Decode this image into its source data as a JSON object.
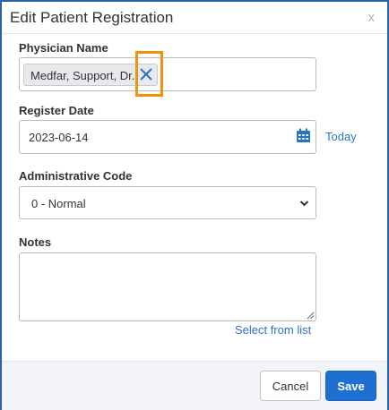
{
  "dialog": {
    "title": "Edit Patient Registration",
    "close_label": "x"
  },
  "physician": {
    "label": "Physician Name",
    "chip_value": "Medfar, Support, Dr."
  },
  "register_date": {
    "label": "Register Date",
    "value": "2023-06-14",
    "today_link": "Today"
  },
  "admin_code": {
    "label": "Administrative Code",
    "selected": "0 - Normal"
  },
  "notes": {
    "label": "Notes",
    "value": "",
    "select_from_list": "Select from list"
  },
  "footer": {
    "cancel_label": "Cancel",
    "save_label": "Save"
  },
  "colors": {
    "accent": "#1f6fd1",
    "link": "#2a73c5",
    "highlight": "#f0930c",
    "border": "#2a63a8"
  },
  "icons": [
    "close-icon",
    "remove-chip-icon",
    "calendar-icon",
    "chevron-down-icon",
    "resize-grip-icon"
  ]
}
